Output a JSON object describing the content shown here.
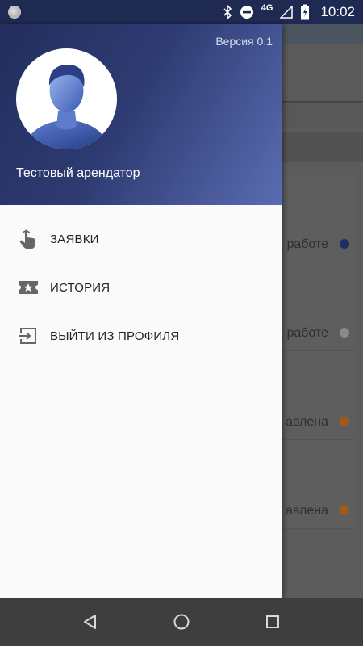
{
  "status_bar": {
    "network": "4G",
    "time": "10:02",
    "icons": [
      "circle-notification-icon",
      "bluetooth-icon",
      "do-not-disturb-icon",
      "signal-icon",
      "battery-charging-icon"
    ]
  },
  "drawer": {
    "version": "Версия 0.1",
    "user_name": "Тестовый арендатор",
    "items": [
      {
        "label": "ЗАЯВКИ",
        "icon": "touch-hand-icon"
      },
      {
        "label": "ИСТОРИЯ",
        "icon": "ticket-star-icon"
      },
      {
        "label": "ВЫЙТИ ИЗ ПРОФИЛЯ",
        "icon": "exit-icon"
      }
    ]
  },
  "background_list": {
    "items": [
      {
        "status": "работе",
        "dot_color": "#1f2f66"
      },
      {
        "status": "работе",
        "dot_color": "#8a8a8a"
      },
      {
        "status": "авлена",
        "dot_color": "#a05a18"
      },
      {
        "status": "авлена",
        "dot_color": "#a05a18"
      }
    ]
  },
  "nav_bar": {
    "icons": [
      "back-icon",
      "home-icon",
      "recents-icon"
    ]
  }
}
